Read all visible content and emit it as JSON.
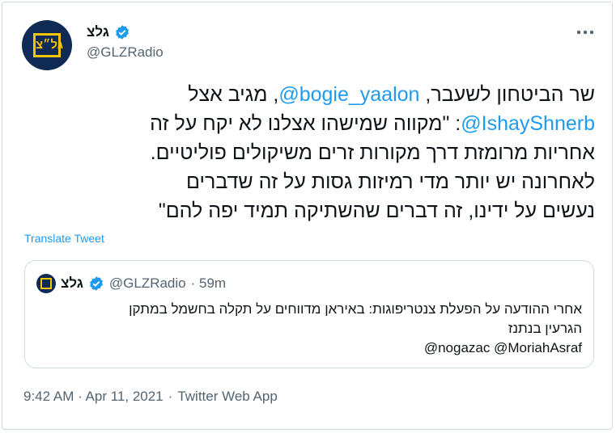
{
  "tweet": {
    "author": {
      "name": "גלצ",
      "handle": "@GLZRadio",
      "avatar_text": "גל״צ"
    },
    "body": {
      "l1_a": "שר הביטחון לשעבר, ",
      "l1_mention": "@bogie_yaalon",
      "l1_b": ", מגיב אצל",
      "l2_mention": "@IshayShnerb",
      "l2_b": ": \"מקווה שמישהו אצלנו לא יקח על זה",
      "l3": "אחריות מרומזת דרך מקורות זרים משיקולים פוליטיים.",
      "l4": "לאחרונה יש יותר מדי רמיזות גסות על זה שדברים",
      "l5": "נעשים על ידינו, זה דברים שהשתיקה תמיד יפה להם\""
    },
    "translate_label": "Translate Tweet",
    "timestamp": "9:42 AM · Apr 11, 2021",
    "source": "Twitter Web App",
    "sep": "·"
  },
  "quote": {
    "name": "גלצ",
    "handle": "@GLZRadio",
    "time": "· 59m",
    "line1": "אחרי ההודעה על הפעלת צנטריפוגות: באיראן מדווחים על תקלה בחשמל במתקן",
    "line2": "הגרעין בנתנז",
    "line3": "@nogazac @MoriahAsraf"
  },
  "icons": {
    "verified": "verified-badge-icon",
    "more": "more-options-icon"
  },
  "colors": {
    "link": "#1d9bf0",
    "muted": "#536471",
    "text": "#0f1419",
    "border": "#cfd9de"
  }
}
